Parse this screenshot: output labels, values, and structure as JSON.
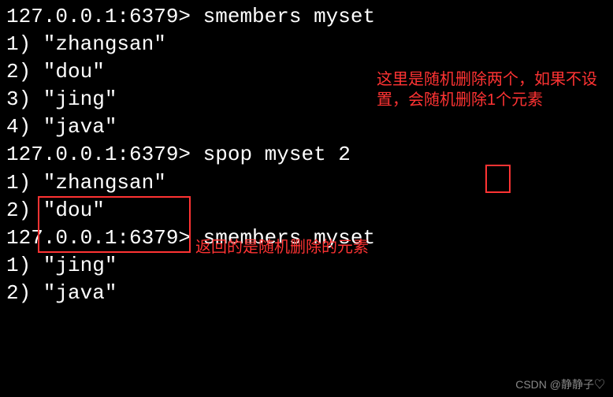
{
  "terminal": {
    "prompt": "127.0.0.1:6379> ",
    "lines": {
      "l0": "127.0.0.1:6379> smembers myset",
      "l1": "1) \"zhangsan\"",
      "l2": "2) \"dou\"",
      "l3": "3) \"jing\"",
      "l4": "4) \"java\"",
      "l5": "127.0.0.1:6379> spop myset 2",
      "l6": "1) \"zhangsan\"",
      "l7": "2) \"dou\"",
      "l8": "127.0.0.1:6379> smembers myset",
      "l9": "1) \"jing\"",
      "l10": "2) \"java\""
    }
  },
  "annotations": {
    "note1": "这里是随机删除两个，如果不设置，会随机删除1个元素",
    "note2": "返回的是随机删除的元素"
  },
  "watermark": "CSDN @静静子♡"
}
